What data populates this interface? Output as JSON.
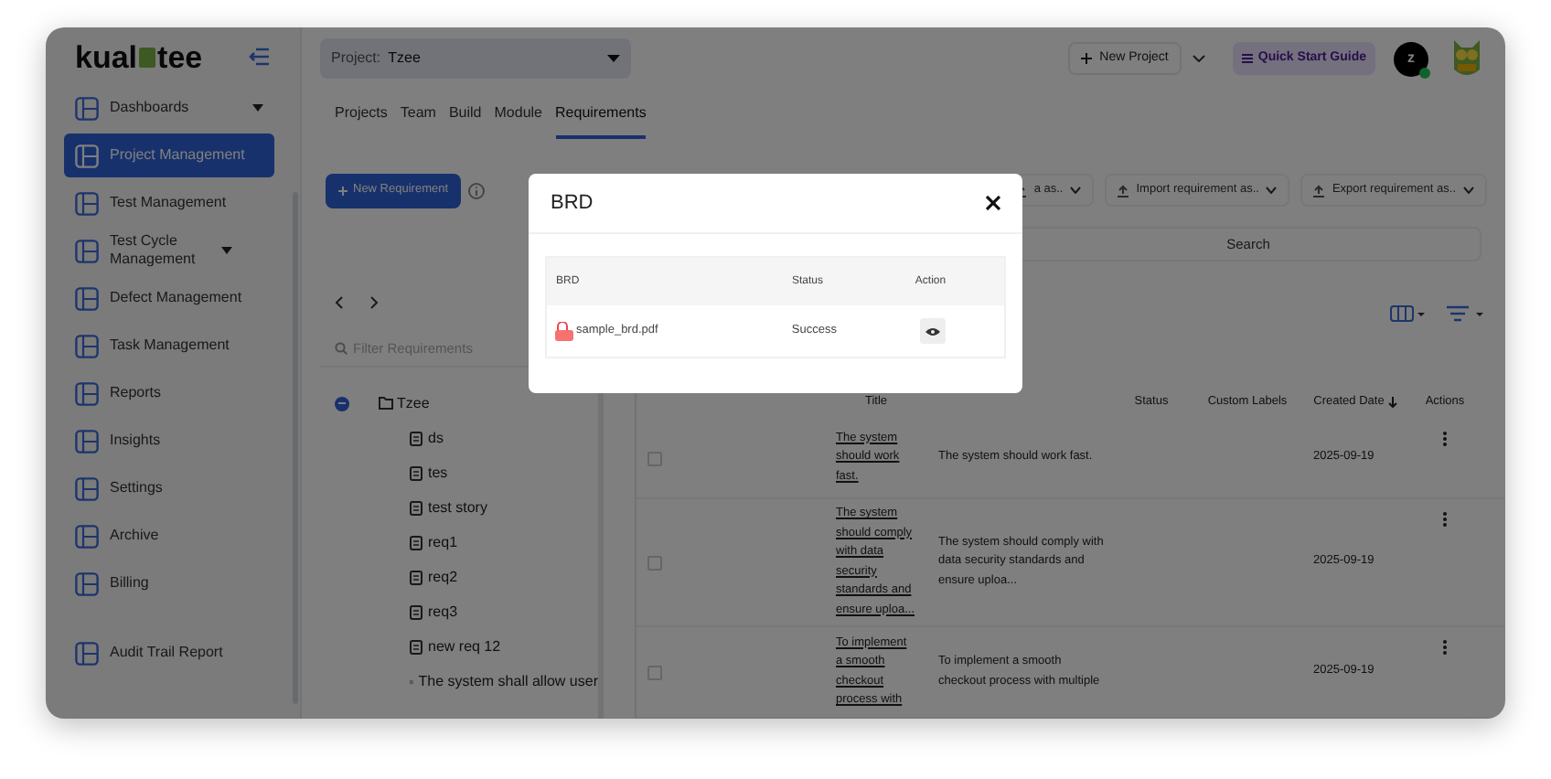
{
  "sidebar": {
    "logo": {
      "left": "kual",
      "right": "tee"
    },
    "items": [
      {
        "label": "Dashboards",
        "selected": false,
        "expandable": true
      },
      {
        "label": "Project Management",
        "selected": true,
        "expandable": false
      },
      {
        "label": "Test Management",
        "selected": false,
        "expandable": false
      },
      {
        "label": "Test Cycle Management",
        "selected": false,
        "expandable": true
      },
      {
        "label": "Defect Management",
        "selected": false,
        "expandable": false
      },
      {
        "label": "Task Management",
        "selected": false,
        "expandable": false
      },
      {
        "label": "Reports",
        "selected": false,
        "expandable": false
      },
      {
        "label": "Insights",
        "selected": false,
        "expandable": false
      },
      {
        "label": "Settings",
        "selected": false,
        "expandable": false
      },
      {
        "label": "Archive",
        "selected": false,
        "expandable": false
      },
      {
        "label": "Billing",
        "selected": false,
        "expandable": false
      },
      {
        "label": "Audit Trail Report",
        "selected": false,
        "expandable": false
      }
    ]
  },
  "header": {
    "project_label": "Project:",
    "project_value": "Tzee",
    "new_project": "New Project",
    "quick_start": "Quick Start Guide",
    "avatar": "z"
  },
  "tabs": [
    {
      "label": "Projects",
      "selected": false
    },
    {
      "label": "Team",
      "selected": false
    },
    {
      "label": "Build",
      "selected": false
    },
    {
      "label": "Module",
      "selected": false
    },
    {
      "label": "Requirements",
      "selected": true
    }
  ],
  "toolbar": {
    "new_requirement": "New Requirement",
    "menus": [
      "a as..",
      "Import requirement as..",
      "Export requirement as.."
    ]
  },
  "search": {
    "placeholder": "Search"
  },
  "tree": {
    "filter_placeholder": "Filter Requirements",
    "items": [
      {
        "label": "Tzee",
        "expanded": true,
        "children": [
          {
            "label": "ds"
          },
          {
            "label": "tes"
          },
          {
            "label": "test story"
          },
          {
            "label": "req1"
          },
          {
            "label": "req2"
          },
          {
            "label": "req3"
          },
          {
            "label": "new req 12"
          },
          {
            "label": "The system shall allow user"
          }
        ]
      }
    ]
  },
  "table": {
    "columns": [
      "Title",
      "Status",
      "Custom Labels",
      "Created Date",
      "Actions"
    ],
    "rows": [
      {
        "checked": false,
        "title": "The system should work fast.",
        "description": "The system should work fast.",
        "date": "2025-09-19"
      },
      {
        "checked": false,
        "title": "The system should comply with data security standards and ensure uploa...",
        "description": "The system should comply with data security standards and ensure uploa...",
        "date": "2025-09-19"
      },
      {
        "checked": false,
        "title": "To implement a smooth checkout process with",
        "description": "To implement a smooth checkout process with multiple",
        "date": "2025-09-19"
      }
    ]
  },
  "modal": {
    "title": "BRD",
    "columns": [
      "BRD",
      "Status",
      "Action"
    ],
    "rows": [
      {
        "file": "sample_brd.pdf",
        "status": "Success"
      }
    ]
  }
}
